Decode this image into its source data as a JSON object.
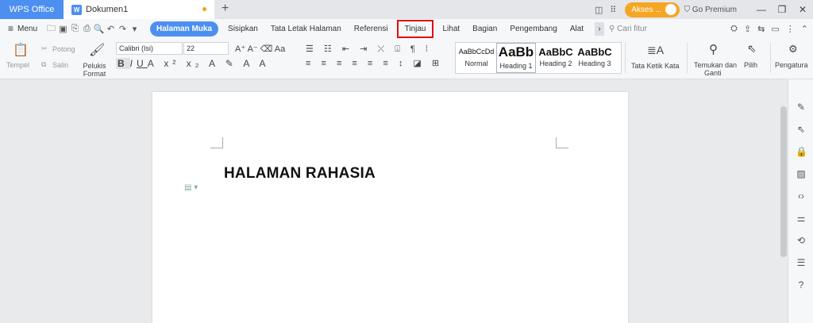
{
  "titlebar": {
    "app_name": "WPS Office",
    "doc_tab": "Dokumen1",
    "new_tab": "+",
    "akses_label": "Akses ...",
    "premium_label": "Go Premium"
  },
  "menubar": {
    "menu_label": "Menu",
    "tabs": [
      "Halaman Muka",
      "Sisipkan",
      "Tata Letak Halaman",
      "Referensi",
      "Tinjau",
      "Lihat",
      "Bagian",
      "Pengembang",
      "Alat"
    ],
    "search_placeholder": "Cari fitur"
  },
  "ribbon": {
    "paste": "Tempel",
    "cut": "Potong",
    "copy": "Salin",
    "format_painter": "Pelukis\nFormat",
    "font_name": "Calibri (Isi)",
    "font_size": "22",
    "styles": [
      {
        "preview": "AaBbCcDd",
        "name": "Normal"
      },
      {
        "preview": "AaBb",
        "name": "Heading 1"
      },
      {
        "preview": "AaBbC",
        "name": "Heading 2"
      },
      {
        "preview": "AaBbC",
        "name": "Heading 3"
      }
    ],
    "text_direction": "Tata Ketik Kata",
    "find_replace_1": "Temukan dan",
    "find_replace_2": "Ganti",
    "select": "Pilih",
    "settings": "Pengatura"
  },
  "document": {
    "heading": "HALAMAN RAHASIA"
  },
  "colors": {
    "accent": "#4d8ff0",
    "akses": "#f5a623",
    "highlight_box": "#e01010"
  }
}
